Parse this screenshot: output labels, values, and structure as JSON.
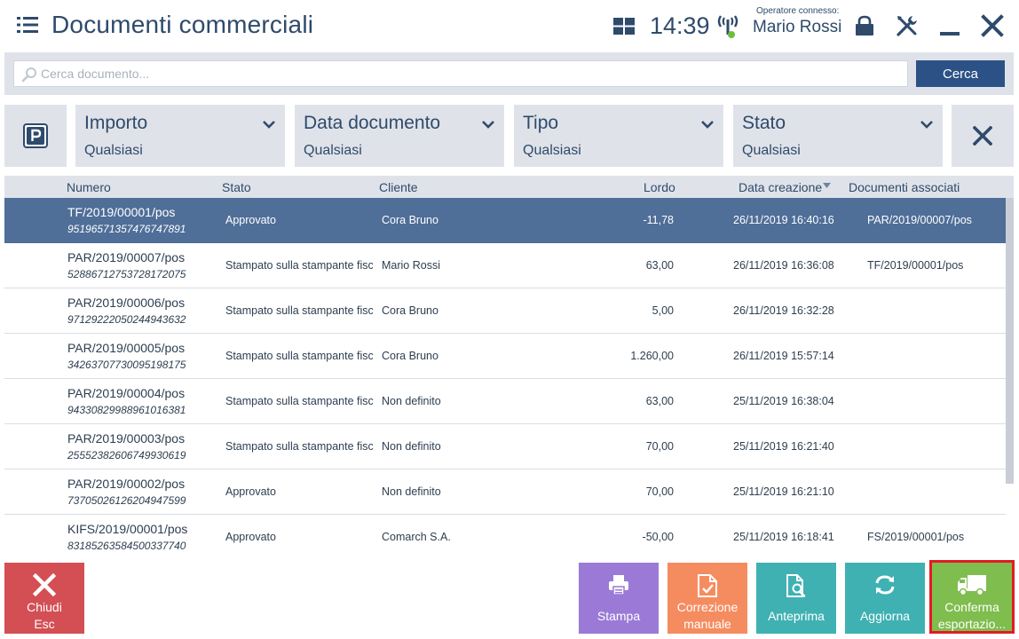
{
  "header": {
    "title": "Documenti commerciali",
    "time": "14:39",
    "operator_label": "Operatore connesso:",
    "operator_name": "Mario Rossi"
  },
  "search": {
    "placeholder": "Cerca documento...",
    "button_label": "Cerca"
  },
  "filters": [
    {
      "label": "Importo",
      "value": "Qualsiasi"
    },
    {
      "label": "Data documento",
      "value": "Qualsiasi"
    },
    {
      "label": "Tipo",
      "value": "Qualsiasi"
    },
    {
      "label": "Stato",
      "value": "Qualsiasi"
    }
  ],
  "table": {
    "columns": {
      "numero": "Numero",
      "stato": "Stato",
      "cliente": "Cliente",
      "lordo": "Lordo",
      "data": "Data creazione",
      "documenti": "Documenti associati"
    },
    "sort_column": "data",
    "sort_direction": "desc",
    "rows": [
      {
        "numero": "TF/2019/00001/pos",
        "codice": "95196571357476747891",
        "stato": "Approvato",
        "cliente": "Cora Bruno",
        "lordo": "-11,78",
        "data": "26/11/2019 16:40:16",
        "documenti": "PAR/2019/00007/pos",
        "selected": true
      },
      {
        "numero": "PAR/2019/00007/pos",
        "codice": "52886712753728172075",
        "stato": "Stampato sulla stampante fisca",
        "cliente": "Mario Rossi",
        "lordo": "63,00",
        "data": "26/11/2019 16:36:08",
        "documenti": "TF/2019/00001/pos",
        "selected": false
      },
      {
        "numero": "PAR/2019/00006/pos",
        "codice": "97129222050244943632",
        "stato": "Stampato sulla stampante fisca",
        "cliente": "Cora Bruno",
        "lordo": "5,00",
        "data": "26/11/2019 16:32:28",
        "documenti": "",
        "selected": false
      },
      {
        "numero": "PAR/2019/00005/pos",
        "codice": "34263707730095198175",
        "stato": "Stampato sulla stampante fisca",
        "cliente": "Cora Bruno",
        "lordo": "1.260,00",
        "data": "26/11/2019 15:57:14",
        "documenti": "",
        "selected": false
      },
      {
        "numero": "PAR/2019/00004/pos",
        "codice": "94330829988961016381",
        "stato": "Stampato sulla stampante fisca",
        "cliente": "Non  definito",
        "lordo": "63,00",
        "data": "25/11/2019 16:38:04",
        "documenti": "",
        "selected": false
      },
      {
        "numero": "PAR/2019/00003/pos",
        "codice": "25552382606749930619",
        "stato": "Stampato sulla stampante fisca",
        "cliente": "Non  definito",
        "lordo": "70,00",
        "data": "25/11/2019 16:21:40",
        "documenti": "",
        "selected": false
      },
      {
        "numero": "PAR/2019/00002/pos",
        "codice": "73705026126204947599",
        "stato": "Approvato",
        "cliente": "Non  definito",
        "lordo": "70,00",
        "data": "25/11/2019 16:21:10",
        "documenti": "",
        "selected": false
      },
      {
        "numero": "KIFS/2019/00001/pos",
        "codice": "83185263584500337740",
        "stato": "Approvato",
        "cliente": "Comarch S.A.",
        "lordo": "-50,00",
        "data": "25/11/2019 16:18:41",
        "documenti": "FS/2019/00001/pos",
        "selected": false
      }
    ]
  },
  "actions": {
    "close_line1": "Chiudi",
    "close_line2": "Esc",
    "print": "Stampa",
    "correct_line1": "Correzione",
    "correct_line2": "manuale",
    "preview": "Anteprima",
    "refresh": "Aggiorna",
    "confirm_line1": "Conferma",
    "confirm_line2": "esportazio..."
  },
  "colors": {
    "brand": "#2f4a6b",
    "search_button": "#2c5186",
    "selected_row": "#4f6e98",
    "close": "#d34f54",
    "print": "#9a7ad6",
    "correct": "#f58c60",
    "preview": "#3fb1b3",
    "refresh": "#3fb1b3",
    "confirm": "#7fbd4e",
    "highlight_border": "#e31b23"
  }
}
